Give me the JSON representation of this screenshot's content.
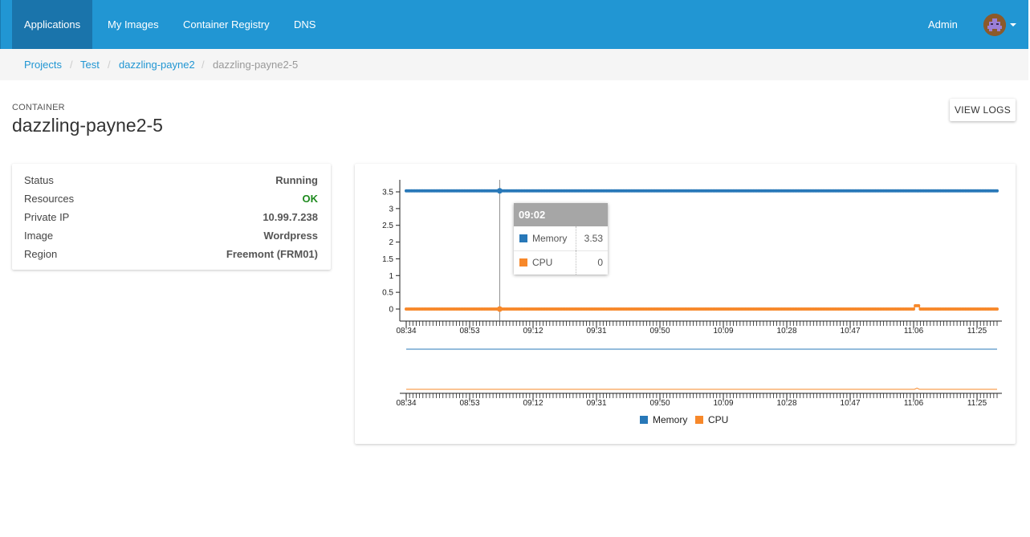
{
  "navbar": {
    "items": [
      {
        "label": "Applications",
        "active": true
      },
      {
        "label": "My Images",
        "active": false
      },
      {
        "label": "Container Registry",
        "active": false
      },
      {
        "label": "DNS",
        "active": false
      }
    ],
    "user_label": "Admin"
  },
  "breadcrumb": {
    "items": [
      "Projects",
      "Test",
      "dazzling-payne2"
    ],
    "current": "dazzling-payne2-5",
    "separator": "/"
  },
  "page": {
    "kicker": "CONTAINER",
    "title": "dazzling-payne2-5",
    "view_logs_label": "VIEW LOGS"
  },
  "info": {
    "rows": [
      {
        "label": "Status",
        "value": "Running",
        "status": "normal"
      },
      {
        "label": "Resources",
        "value": "OK",
        "status": "ok"
      },
      {
        "label": "Private IP",
        "value": "10.99.7.238",
        "status": "normal"
      },
      {
        "label": "Image",
        "value": "Wordpress",
        "status": "normal"
      },
      {
        "label": "Region",
        "value": "Freemont (FRM01)",
        "status": "normal"
      }
    ]
  },
  "colors": {
    "nav_bg": "#2196d3",
    "nav_active": "#1a74ab",
    "link": "#2196d3",
    "ok": "#1e8a1e",
    "memory": "#2878b8",
    "cpu": "#f7882a"
  },
  "tooltip": {
    "time": "09:02",
    "rows": [
      {
        "name": "Memory",
        "value": "3.53"
      },
      {
        "name": "CPU",
        "value": "0"
      }
    ]
  },
  "chart_data": {
    "type": "line",
    "x_start_minute": 514,
    "x_end_minute": 691,
    "x_tick_labels": [
      "08:34",
      "08:53",
      "09:12",
      "09:31",
      "09:50",
      "10:09",
      "10:28",
      "10:47",
      "11:06",
      "11:25"
    ],
    "x_tick_minutes": [
      514,
      533,
      552,
      571,
      590,
      609,
      628,
      647,
      666,
      685
    ],
    "ylim": [
      0,
      3.5
    ],
    "y_ticks": [
      0,
      0.5,
      1,
      1.5,
      2,
      2.5,
      3,
      3.5
    ],
    "series": [
      {
        "name": "Memory",
        "value": 3.53
      },
      {
        "name": "CPU",
        "value": 0,
        "spike_minute": 667,
        "spike_value": 0.05
      }
    ],
    "hover_minute": 542,
    "legend_position": "bottom",
    "grid": false
  }
}
